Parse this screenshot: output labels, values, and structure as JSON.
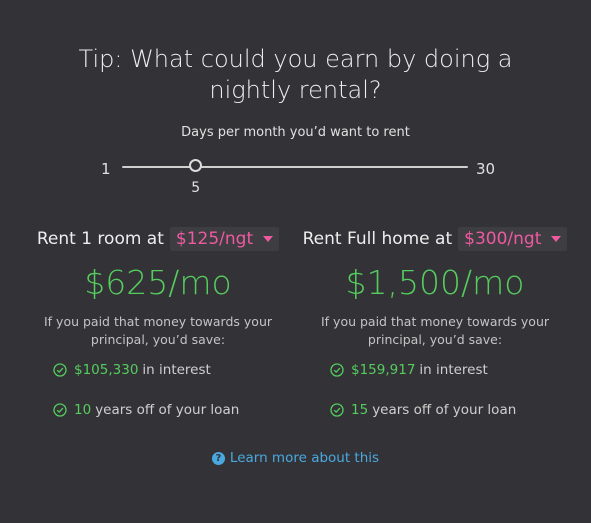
{
  "title": "Tip: What could you earn by doing a nightly rental?",
  "slider": {
    "label": "Days per month you’d want to rent",
    "min": "1",
    "max": "30",
    "value": "5",
    "value_num": 5,
    "min_num": 1,
    "max_num": 30
  },
  "options": [
    {
      "rent_label": "Rent 1 room at",
      "price": "$125/ngt",
      "monthly": "$625/mo",
      "explain": "If you paid that money towards your principal, you’d save:",
      "interest_value": "$105,330",
      "interest_suffix": "in interest",
      "years_value": "10",
      "years_suffix": "years off of your loan"
    },
    {
      "rent_label": "Rent Full home at",
      "price": "$300/ngt",
      "monthly": "$1,500/mo",
      "explain": "If you paid that money towards your principal, you’d save:",
      "interest_value": "$159,917",
      "interest_suffix": "in interest",
      "years_value": "15",
      "years_suffix": "years off of your loan"
    }
  ],
  "learn_more": {
    "icon": "question-circle-icon",
    "label": "Learn more about this"
  },
  "colors": {
    "background": "#333337",
    "accent_green": "#55cc5e",
    "accent_pink": "#ee5aa0",
    "link_blue": "#4aa8e0"
  }
}
